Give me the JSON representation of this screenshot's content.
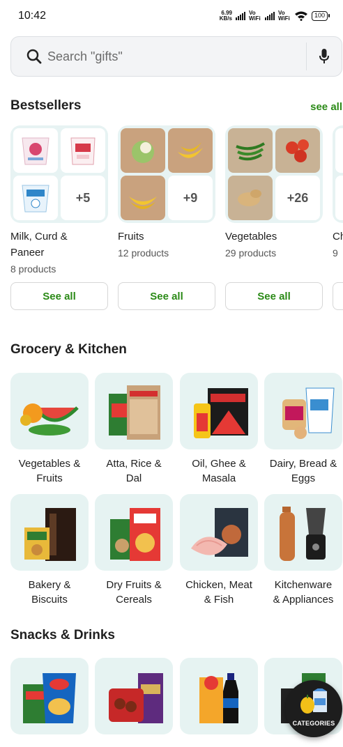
{
  "status_bar": {
    "time": "10:42",
    "speed_value": "6.99",
    "speed_unit": "KB/s",
    "sim1": "Vo WiFi",
    "sim2": "Vo WiFi",
    "battery": "100"
  },
  "search": {
    "placeholder": "Search \"gifts\"",
    "search_icon": "search-icon",
    "mic_icon": "microphone-icon"
  },
  "bestsellers": {
    "title": "Bestsellers",
    "see_all": "see all",
    "cards": [
      {
        "name_line1": "Milk, Curd &",
        "name_line2": "Paneer",
        "count": "8 products",
        "more": "+5",
        "button": "See all"
      },
      {
        "name_line1": "Fruits",
        "count": "12 products",
        "more": "+9",
        "button": "See all"
      },
      {
        "name_line1": "Vegetables",
        "count": "29 products",
        "more": "+26",
        "button": "See all"
      },
      {
        "name_line1": "Ch",
        "count": "9"
      }
    ]
  },
  "grocery": {
    "title": "Grocery & Kitchen",
    "items": [
      {
        "line1": "Vegetables &",
        "line2": "Fruits"
      },
      {
        "line1": "Atta, Rice &",
        "line2": "Dal"
      },
      {
        "line1": "Oil, Ghee &",
        "line2": "Masala"
      },
      {
        "line1": "Dairy, Bread &",
        "line2": "Eggs"
      },
      {
        "line1": "Bakery &",
        "line2": "Biscuits"
      },
      {
        "line1": "Dry Fruits &",
        "line2": "Cereals"
      },
      {
        "line1": "Chicken, Meat",
        "line2": "& Fish"
      },
      {
        "line1": "Kitchenware",
        "line2": "& Appliances"
      }
    ]
  },
  "snacks": {
    "title": "Snacks & Drinks"
  },
  "fab": {
    "label": "CATEGORIES"
  },
  "colors": {
    "accent_green": "#2b8a17",
    "tile_bg": "#e6f3f2"
  }
}
